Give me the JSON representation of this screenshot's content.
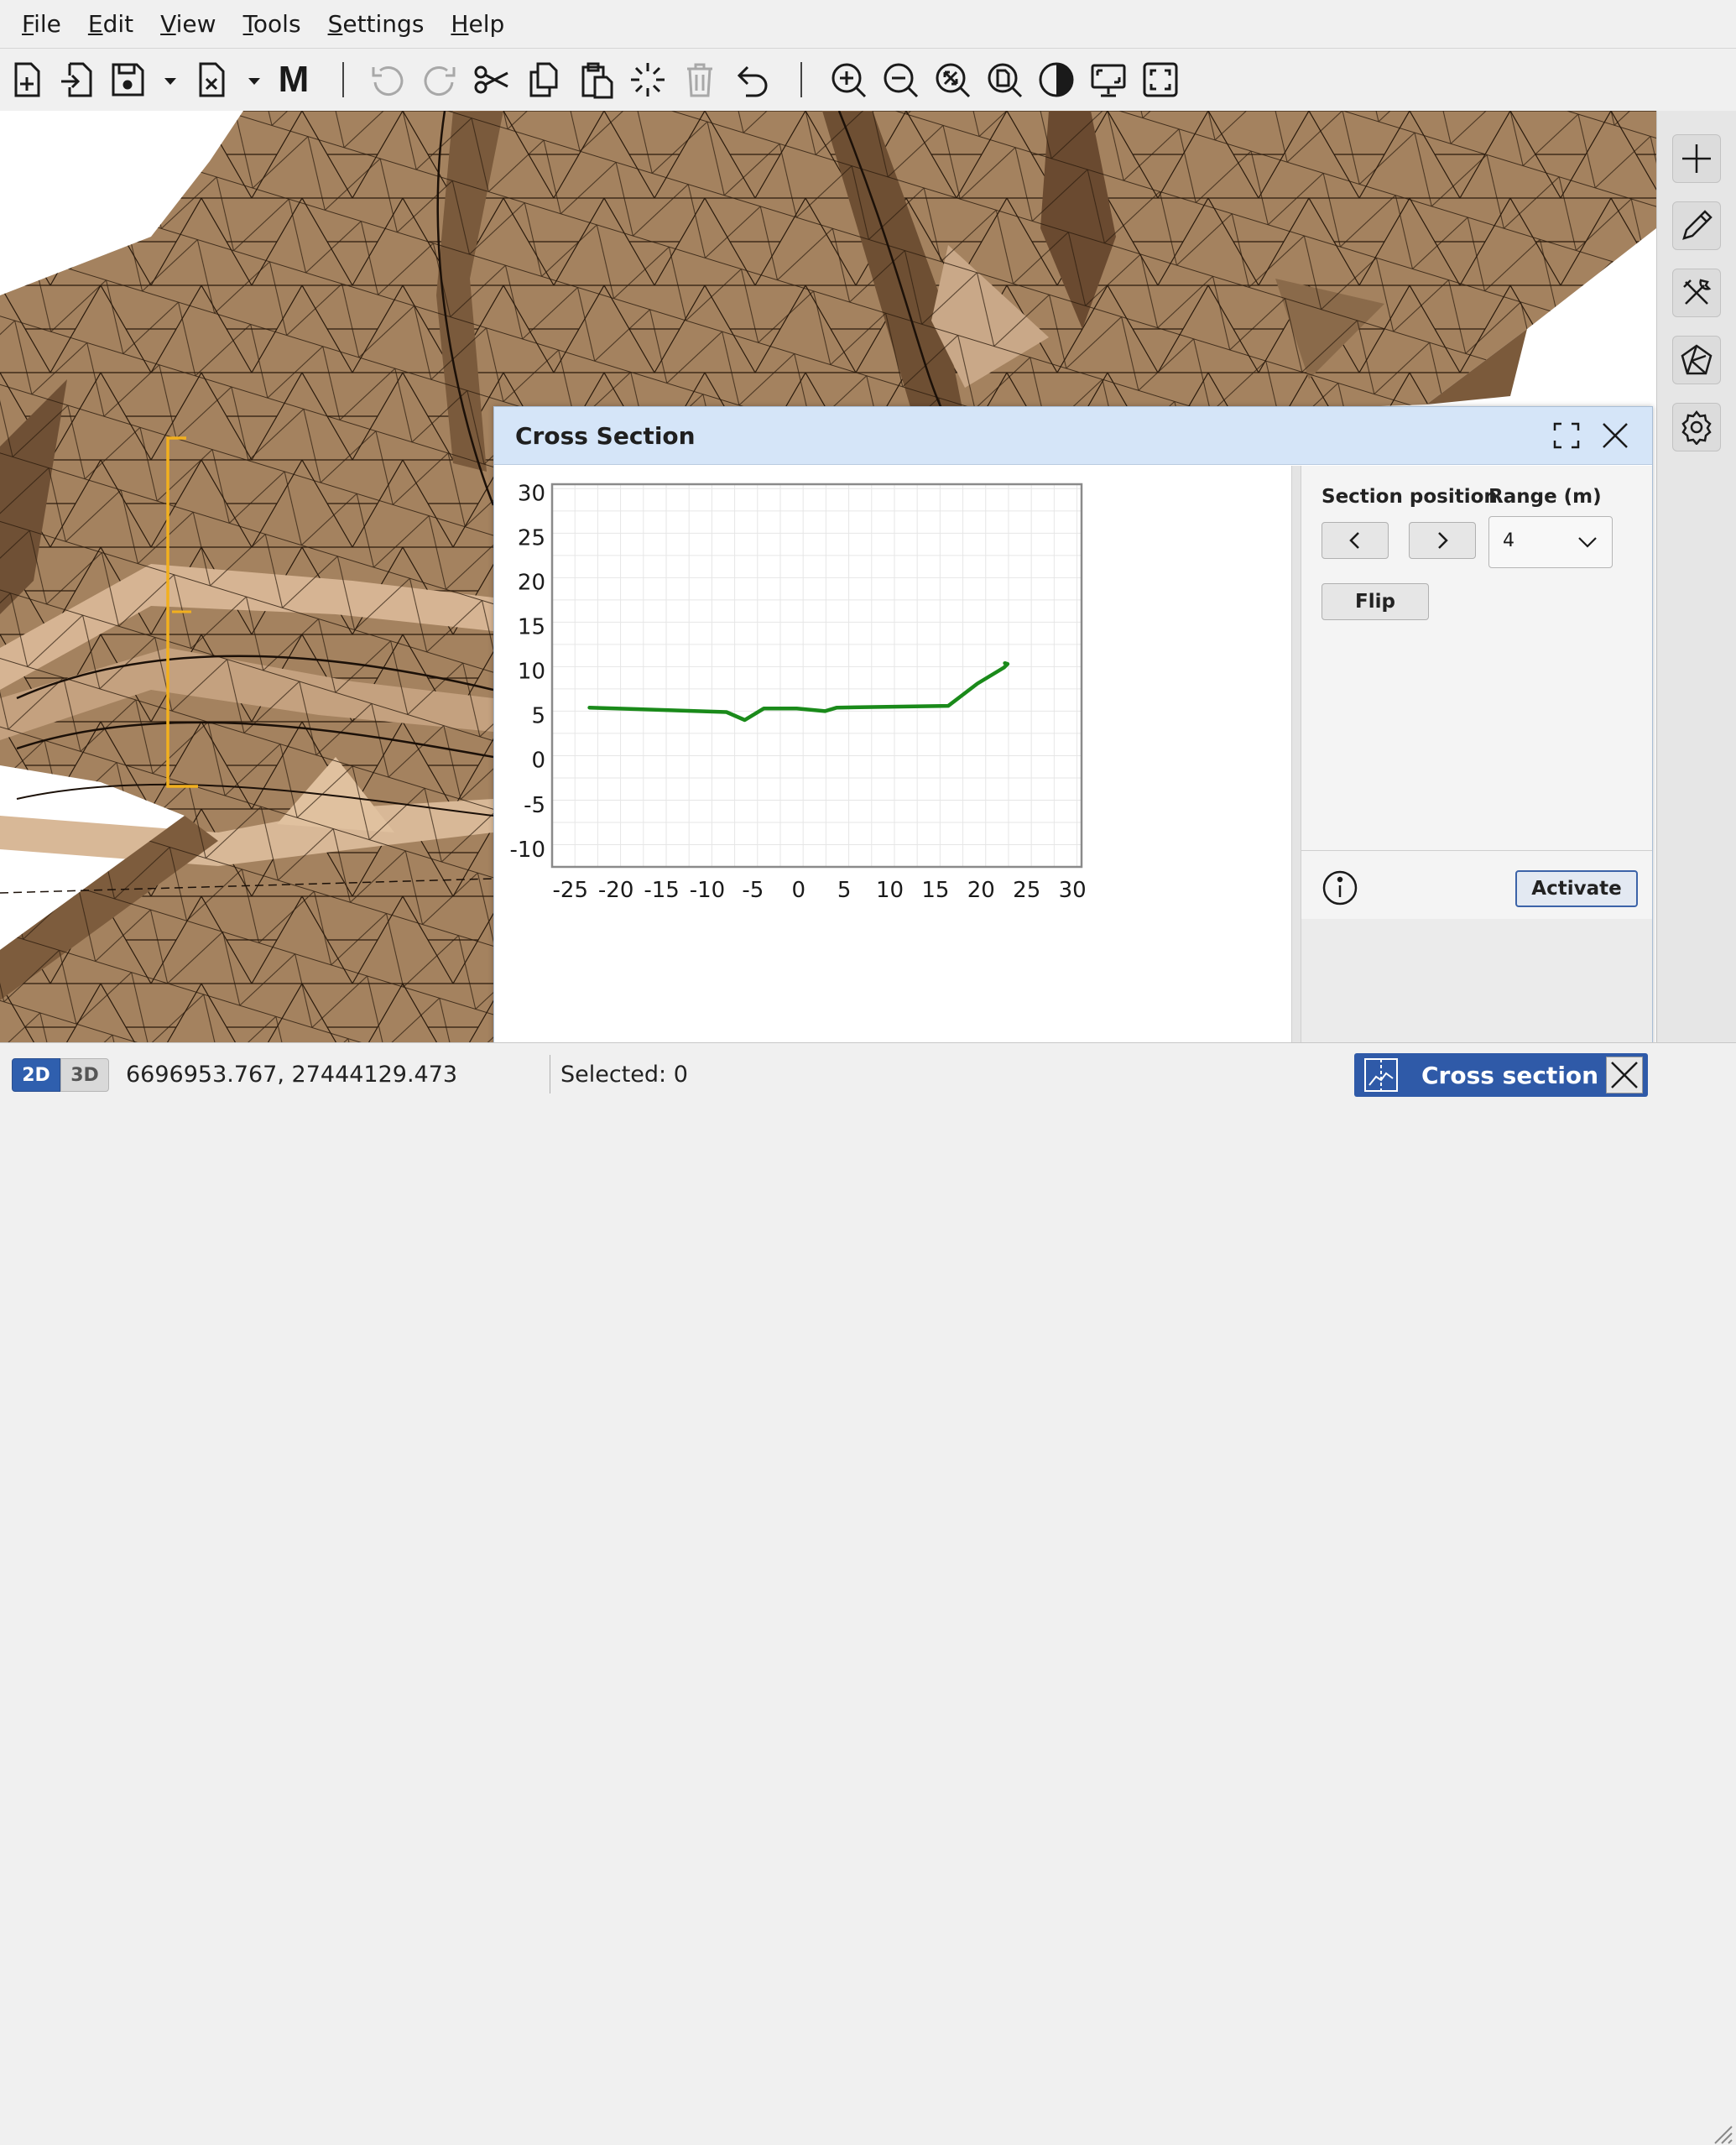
{
  "menu": {
    "items": [
      {
        "accel": "F",
        "rest": "ile"
      },
      {
        "accel": "E",
        "rest": "dit"
      },
      {
        "accel": "V",
        "rest": "iew"
      },
      {
        "accel": "T",
        "rest": "ools"
      },
      {
        "accel": "S",
        "rest": "ettings"
      },
      {
        "accel": "H",
        "rest": "elp"
      }
    ]
  },
  "toolbar": {
    "icons": [
      "new-file-icon",
      "import-icon",
      "save-icon",
      "export-icon",
      "model-icon",
      "undo-icon",
      "redo-icon",
      "cut-icon",
      "copy-icon",
      "paste-icon",
      "select-icon",
      "delete-icon",
      "revert-icon",
      "zoom-in-icon",
      "zoom-out-icon",
      "zoom-extents-icon",
      "zoom-page-icon",
      "contrast-icon",
      "monitor-icon",
      "fullscreen-icon"
    ],
    "model_glyph": "M"
  },
  "rail": {
    "icons": [
      "add-icon",
      "pencil-icon",
      "tools-icon",
      "polyhedron-icon",
      "settings-icon"
    ]
  },
  "dialog": {
    "title": "Cross Section",
    "panel": {
      "section_position_label": "Section position",
      "range_label": "Range (m)",
      "range_value": "4",
      "flip_label": "Flip",
      "activate_label": "Activate"
    }
  },
  "chart_data": {
    "type": "line",
    "title": "",
    "xlabel": "",
    "ylabel": "",
    "xlim": [
      -27,
      31
    ],
    "ylim": [
      -12,
      31
    ],
    "x_ticks": [
      -25,
      -20,
      -15,
      -10,
      -5,
      0,
      5,
      10,
      15,
      20,
      25,
      30
    ],
    "y_ticks": [
      30,
      25,
      20,
      15,
      10,
      5,
      0,
      -5,
      -10
    ],
    "grid": true,
    "series": [
      {
        "name": "",
        "color": "#1a8a1a",
        "x": [
          -22.9,
          -7.9,
          -5.9,
          -3.8,
          -0.2,
          2.9,
          4.2,
          16.4,
          19.6,
          22.5,
          22.9,
          22.6
        ],
        "y": [
          5.9,
          5.4,
          4.5,
          5.8,
          5.8,
          5.5,
          5.9,
          6.1,
          8.6,
          10.4,
          10.8,
          10.9
        ]
      }
    ]
  },
  "status": {
    "mode_2d": "2D",
    "mode_3d": "3D",
    "coordinates": "6696953.767, 27444129.473",
    "selected": "Selected: 0",
    "cross_section_badge": "Cross section"
  },
  "colors": {
    "dialog_header": "#d5e5f8",
    "accent": "#2f5aa8",
    "terrain": "#9c7a5a",
    "series_line": "#1a8a1a",
    "section_marker": "#f2b01e"
  }
}
